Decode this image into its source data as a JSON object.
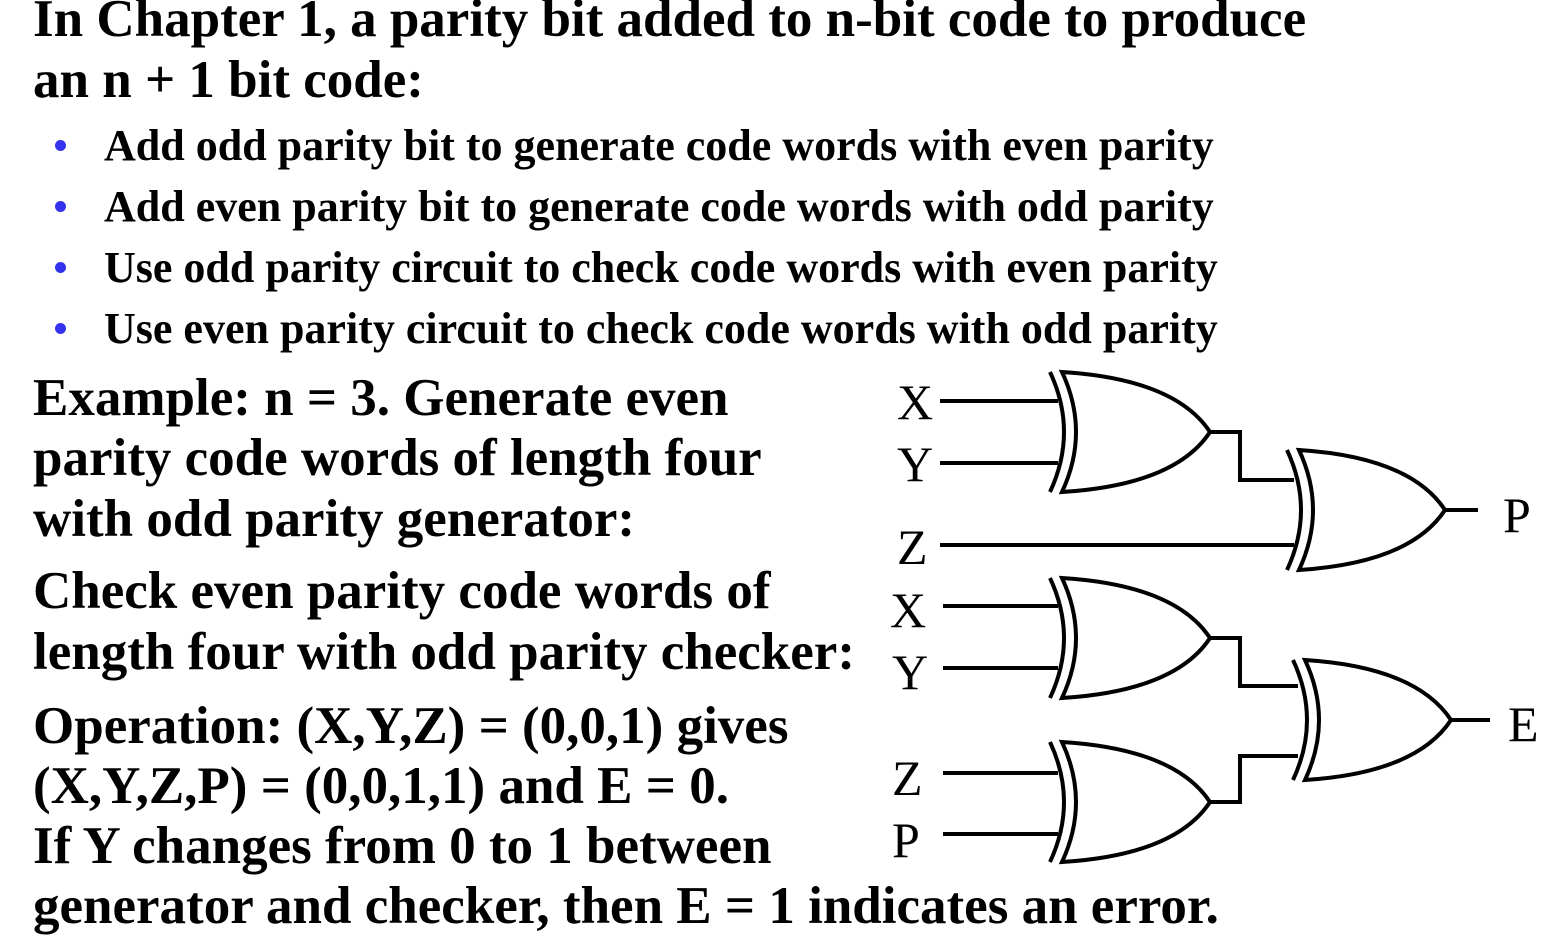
{
  "heading": {
    "line1": "In Chapter 1, a parity bit added to n-bit code to produce",
    "line2": "an n + 1 bit code:"
  },
  "bullets": [
    "Add odd parity bit to generate code words with even parity",
    "Add even parity bit to generate code words with odd parity",
    "Use odd parity circuit to check code words with even parity",
    "Use even parity circuit to check code words with odd parity"
  ],
  "example": {
    "line1": "Example: n = 3. Generate even",
    "line2": "parity code words of length four",
    "line3": "with odd parity generator:"
  },
  "check": {
    "line1": "Check even parity code words of",
    "line2": "length four with odd parity checker:"
  },
  "operation": {
    "line1": "Operation: (X,Y,Z) = (0,0,1) gives",
    "line2": "(X,Y,Z,P) = (0,0,1,1) and E = 0.",
    "line3": "If Y changes from 0 to 1 between",
    "line4": "generator and checker, then E = 1 indicates an error."
  },
  "circuit": {
    "generator": {
      "inputs": [
        "X",
        "Y",
        "Z"
      ],
      "output": "P"
    },
    "checker": {
      "inputs": [
        "X",
        "Y",
        "Z",
        "P"
      ],
      "output": "E"
    }
  },
  "colors": {
    "text": "#000000",
    "bullet": "#3333ee",
    "background": "#ffffff"
  }
}
